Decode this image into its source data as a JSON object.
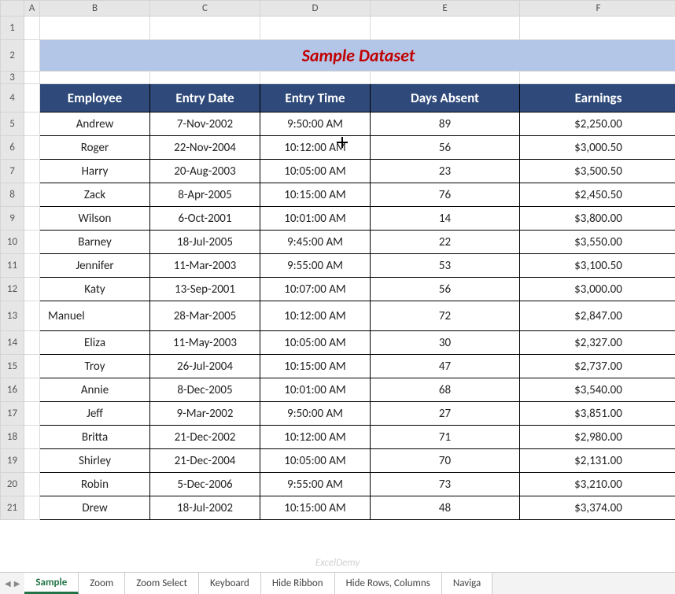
{
  "columns": [
    "A",
    "B",
    "C",
    "D",
    "E",
    "F"
  ],
  "rowNumbers": [
    1,
    2,
    3,
    4,
    5,
    6,
    7,
    8,
    9,
    10,
    11,
    12,
    13,
    14,
    15,
    16,
    17,
    18,
    19,
    20,
    21
  ],
  "title": "Sample Dataset",
  "headers": [
    "Employee",
    "Entry Date",
    "Entry Time",
    "Days Absent",
    "Earnings"
  ],
  "rows": [
    {
      "emp": "Andrew",
      "date": "7-Nov-2002",
      "time": "9:50:00 AM",
      "abs": "89",
      "earn": "$2,250.00"
    },
    {
      "emp": "Roger",
      "date": "22-Nov-2004",
      "time": "10:12:00 AM",
      "abs": "56",
      "earn": "$3,000.50"
    },
    {
      "emp": "Harry",
      "date": "20-Aug-2003",
      "time": "10:05:00 AM",
      "abs": "23",
      "earn": "$3,500.50"
    },
    {
      "emp": "Zack",
      "date": "8-Apr-2005",
      "time": "10:15:00 AM",
      "abs": "76",
      "earn": "$2,450.50"
    },
    {
      "emp": "Wilson",
      "date": "6-Oct-2001",
      "time": "10:01:00 AM",
      "abs": "14",
      "earn": "$3,800.00"
    },
    {
      "emp": "Barney",
      "date": "18-Jul-2005",
      "time": "9:45:00 AM",
      "abs": "22",
      "earn": "$3,550.00"
    },
    {
      "emp": "Jennifer",
      "date": "11-Mar-2003",
      "time": "9:55:00 AM",
      "abs": "53",
      "earn": "$3,100.50"
    },
    {
      "emp": "Katy",
      "date": "13-Sep-2001",
      "time": "10:07:00 AM",
      "abs": "56",
      "earn": "$3,000.00"
    },
    {
      "emp": "Manuel",
      "date": "28-Mar-2005",
      "time": "10:12:00 AM",
      "abs": "72",
      "earn": "$2,847.00"
    },
    {
      "emp": "Eliza",
      "date": "11-May-2003",
      "time": "10:05:00 AM",
      "abs": "30",
      "earn": "$2,327.00"
    },
    {
      "emp": "Troy",
      "date": "26-Jul-2004",
      "time": "10:15:00 AM",
      "abs": "47",
      "earn": "$2,737.00"
    },
    {
      "emp": "Annie",
      "date": "8-Dec-2005",
      "time": "10:01:00 AM",
      "abs": "68",
      "earn": "$3,540.00"
    },
    {
      "emp": "Jeff",
      "date": "9-Mar-2002",
      "time": "9:50:00 AM",
      "abs": "27",
      "earn": "$3,851.00"
    },
    {
      "emp": "Britta",
      "date": "21-Dec-2002",
      "time": "10:12:00 AM",
      "abs": "71",
      "earn": "$2,980.00"
    },
    {
      "emp": "Shirley",
      "date": "21-Dec-2004",
      "time": "10:05:00 AM",
      "abs": "70",
      "earn": "$2,131.00"
    },
    {
      "emp": "Robin",
      "date": "5-Dec-2006",
      "time": "9:55:00 AM",
      "abs": "73",
      "earn": "$3,210.00"
    },
    {
      "emp": "Drew",
      "date": "18-Jul-2002",
      "time": "10:15:00 AM",
      "abs": "48",
      "earn": "$3,374.00"
    }
  ],
  "tabs": [
    "Sample",
    "Zoom",
    "Zoom Select",
    "Keyboard",
    "Hide Ribbon",
    "Hide Rows, Columns",
    "Naviga"
  ],
  "activeTab": 0,
  "watermark": "ExcelDemy",
  "colWidths": {
    "A": 20,
    "B": 140,
    "C": 140,
    "D": 140,
    "E": 190,
    "F": 200
  }
}
